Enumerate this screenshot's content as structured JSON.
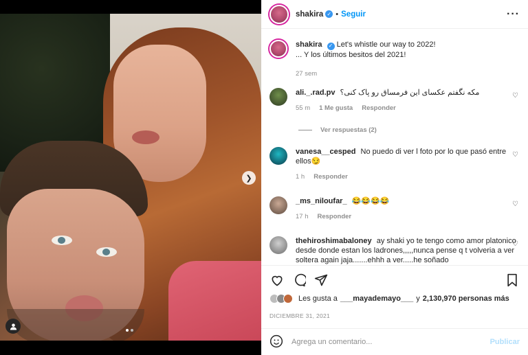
{
  "colors": {
    "accent": "#0095f6",
    "verified": "#3897f0",
    "muted": "#8e8e8e",
    "publish_disabled": "#b2dffc"
  },
  "header": {
    "username": "shakira",
    "follow_label": "Seguir",
    "more_icon": "more-horizontal-icon"
  },
  "caption": {
    "username": "shakira",
    "line1": "Let's whistle our way to 2022!",
    "line2": "... Y los últimos besitos del 2021!",
    "time": "27 sem"
  },
  "comments": [
    {
      "username": "ali._.rad.pv",
      "text": "مکه نگفتم عکسای این فرمساق رو پاک کنی؟",
      "time": "55 m",
      "likes": "1 Me gusta",
      "reply": "Responder",
      "view_replies": "Ver respuestas (2)"
    },
    {
      "username": "vanesa__cesped",
      "text": "No puedo di ver l foto por lo que pasó entre ellos😏",
      "time": "1 h",
      "reply": "Responder"
    },
    {
      "username": "_ms_niloufar_",
      "text": "😂😂😂😂",
      "time": "17 h",
      "reply": "Responder"
    },
    {
      "username": "thehiroshimabaloney",
      "text": "ay shaki yo te tengo como amor platonico desde donde estan los ladrones,,,,,nunca pense q t volveria a ver soltera again jaja.......ehhh a ver.....he soñado"
    }
  ],
  "actions": {
    "like_icon": "heart-icon",
    "comment_icon": "comment-icon",
    "share_icon": "share-icon",
    "save_icon": "bookmark-icon"
  },
  "likes": {
    "prefix": "Les gusta a",
    "user": "___mayademayo___",
    "middle": "y",
    "count": "2,130,970 personas más"
  },
  "date": "DICIEMBRE 31, 2021",
  "composer": {
    "placeholder": "Agrega un comentario...",
    "publish_label": "Publicar",
    "emoji_icon": "emoji-icon"
  },
  "carousel": {
    "current": 1,
    "total": 2
  }
}
